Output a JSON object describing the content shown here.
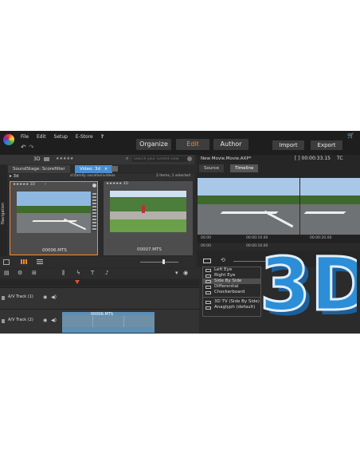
{
  "menu": [
    "File",
    "Edit",
    "Setup",
    "E-Store",
    "?"
  ],
  "modes": [
    "Organize",
    "Edit",
    "Author"
  ],
  "actions": {
    "import": "Import",
    "export": "Export"
  },
  "title_timecode": "[ ] 00:00:33.15",
  "tc_label": "TC",
  "project": "New Movie.Movie.AXP*",
  "library": {
    "filter_label": "3D",
    "stars": "★★★★★",
    "search_placeholder": "Search your current view",
    "tabs": [
      "SoundStage: Scorefitter",
      "Video: 3d"
    ],
    "tab_close": "×",
    "breadcrumb": "3d",
    "path": "d:\\family vacation\\videos",
    "count": "2 items, 1 selected",
    "side_label": "Navigation",
    "clips": [
      {
        "stars": "★★★★★ 3D",
        "name": "00006.MTS"
      },
      {
        "stars": "★★★★★ 3D",
        "name": "00007.MTS"
      }
    ]
  },
  "player": {
    "tabs": [
      "Source",
      "Timeline"
    ],
    "ruler": [
      "00:00",
      "00:00:10.00",
      "00:00:20.00"
    ],
    "ruler2": [
      "00:00",
      "00:00:10.00"
    ]
  },
  "stereo_menu": {
    "items": [
      "Left Eye",
      "Right Eye",
      "Side By Side",
      "Differential",
      "Checkerboard",
      "3D TV (Side By Side)",
      "Anaglyph  (default)"
    ],
    "selected": "Side By Side"
  },
  "timeline": {
    "tracks": [
      "A/V Track (1)",
      "A/V Track (2)"
    ],
    "clip_name": "00006.MTS"
  },
  "logo": {
    "text": "3D"
  },
  "colors": {
    "accent": "#ff8a1f",
    "selection": "#4a8ed1",
    "logo_blue": "#2c8ed6"
  }
}
